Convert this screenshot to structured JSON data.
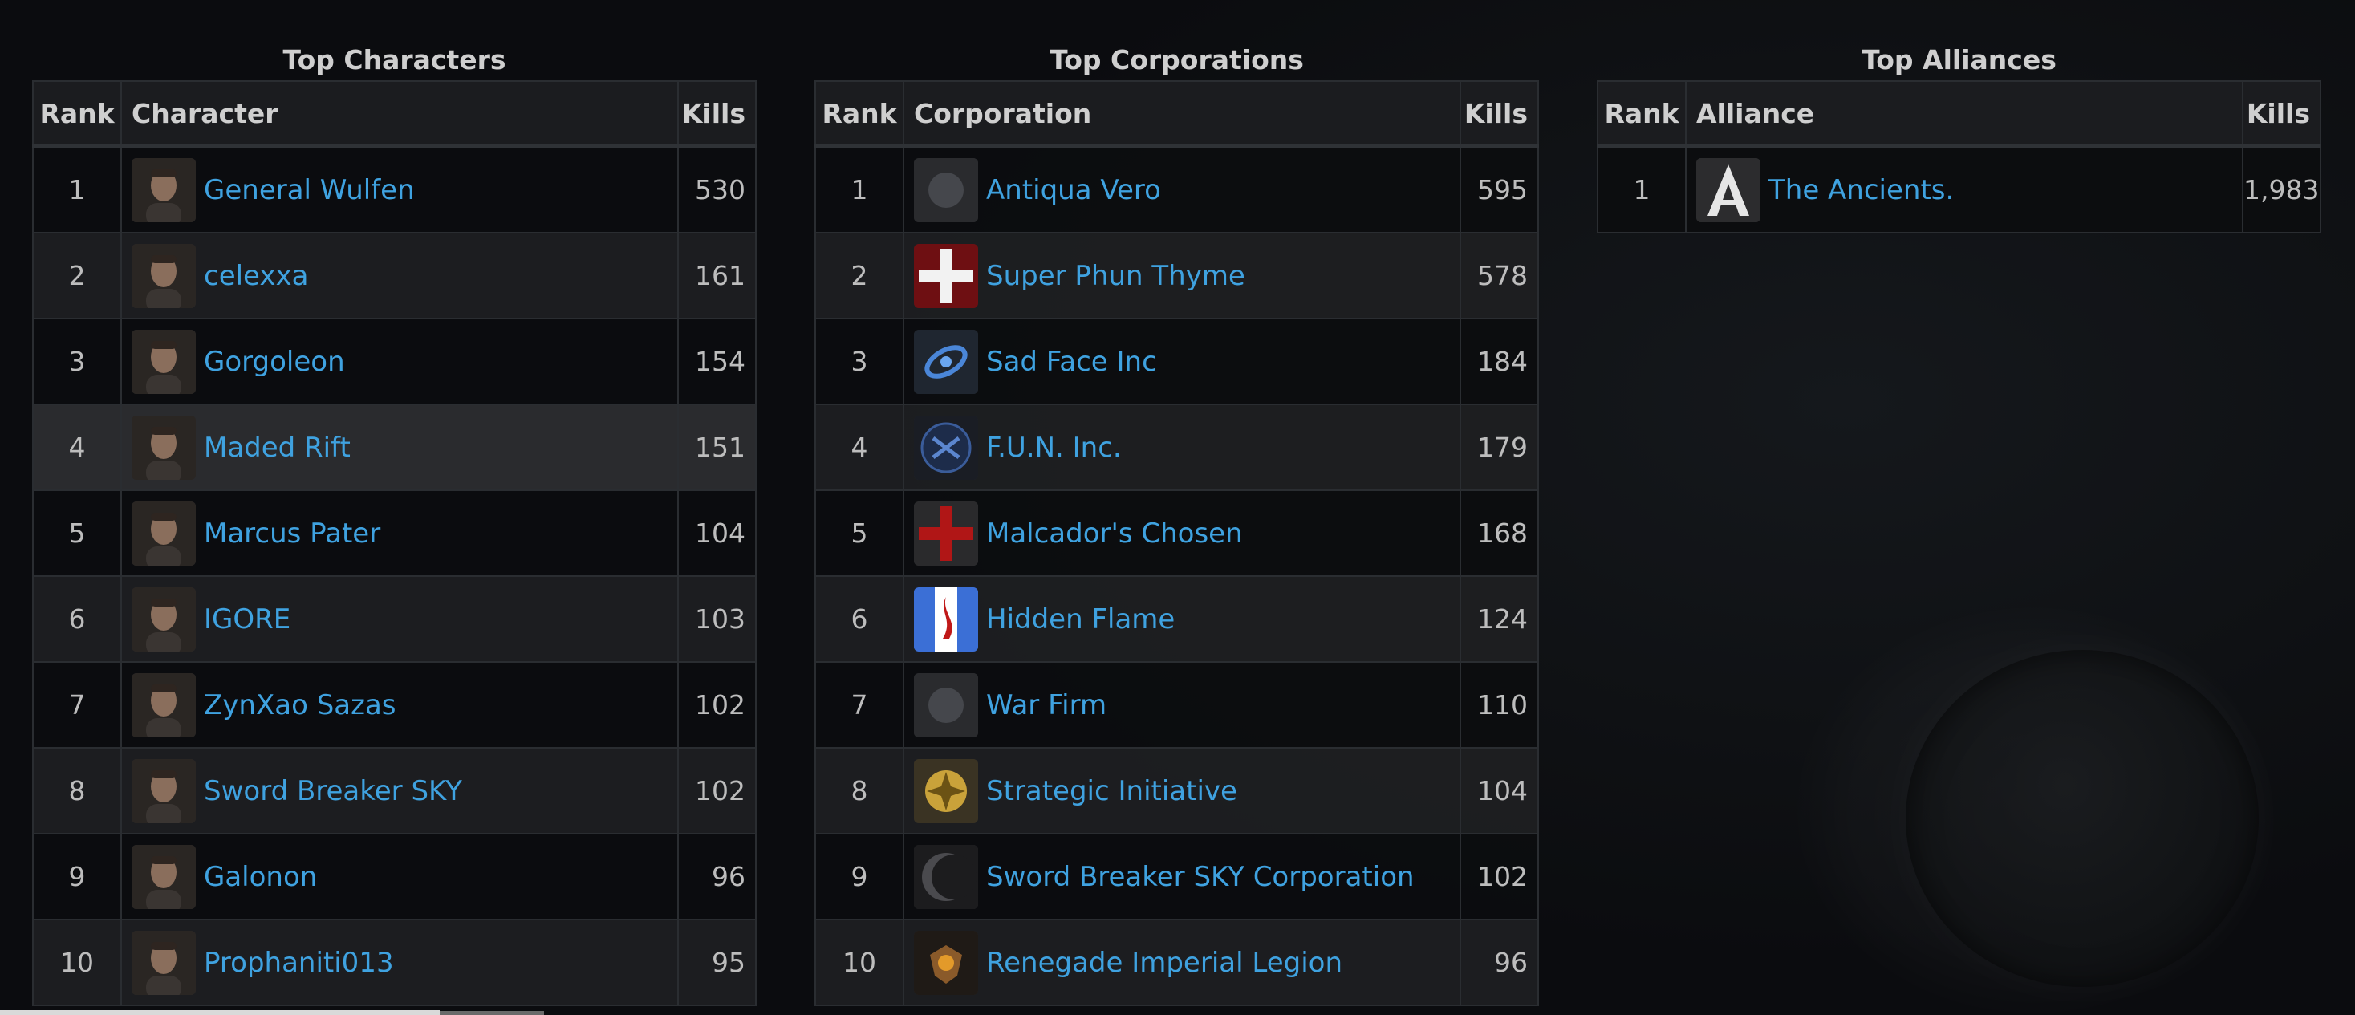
{
  "panels": [
    {
      "title": "Top Characters",
      "headers": {
        "rank": "Rank",
        "name": "Character",
        "kills": "Kills"
      },
      "rows": [
        {
          "rank": "1",
          "name": "General Wulfen",
          "kills": "530",
          "icon": "character-portrait-icon"
        },
        {
          "rank": "2",
          "name": "celexxa",
          "kills": "161",
          "icon": "character-portrait-icon"
        },
        {
          "rank": "3",
          "name": "Gorgoleon",
          "kills": "154",
          "icon": "character-portrait-icon"
        },
        {
          "rank": "4",
          "name": "Maded Rift",
          "kills": "151",
          "icon": "character-portrait-icon"
        },
        {
          "rank": "5",
          "name": "Marcus Pater",
          "kills": "104",
          "icon": "character-portrait-icon"
        },
        {
          "rank": "6",
          "name": "IGORE",
          "kills": "103",
          "icon": "character-portrait-icon"
        },
        {
          "rank": "7",
          "name": "ZynXao Sazas",
          "kills": "102",
          "icon": "character-portrait-icon"
        },
        {
          "rank": "8",
          "name": "Sword Breaker SKY",
          "kills": "102",
          "icon": "character-portrait-icon"
        },
        {
          "rank": "9",
          "name": "Galonon",
          "kills": "96",
          "icon": "character-portrait-icon"
        },
        {
          "rank": "10",
          "name": "Prophaniti013",
          "kills": "95",
          "icon": "character-portrait-icon"
        }
      ]
    },
    {
      "title": "Top Corporations",
      "headers": {
        "rank": "Rank",
        "name": "Corporation",
        "kills": "Kills"
      },
      "rows": [
        {
          "rank": "1",
          "name": "Antiqua Vero",
          "kills": "595",
          "icon": "corporation-logo-icon"
        },
        {
          "rank": "2",
          "name": "Super Phun Thyme",
          "kills": "578",
          "icon": "white-cross-logo-icon"
        },
        {
          "rank": "3",
          "name": "Sad Face Inc",
          "kills": "184",
          "icon": "blue-swirl-logo-icon"
        },
        {
          "rank": "4",
          "name": "F.U.N. Inc.",
          "kills": "179",
          "icon": "blue-emblem-logo-icon"
        },
        {
          "rank": "5",
          "name": "Malcador's Chosen",
          "kills": "168",
          "icon": "red-cross-logo-icon"
        },
        {
          "rank": "6",
          "name": "Hidden Flame",
          "kills": "124",
          "icon": "flame-logo-icon"
        },
        {
          "rank": "7",
          "name": "War Firm",
          "kills": "110",
          "icon": "corporation-logo-icon"
        },
        {
          "rank": "8",
          "name": "Strategic Initiative",
          "kills": "104",
          "icon": "gold-emblem-logo-icon"
        },
        {
          "rank": "9",
          "name": "Sword Breaker SKY Corporation",
          "kills": "102",
          "icon": "crescent-logo-icon"
        },
        {
          "rank": "10",
          "name": "Renegade Imperial Legion",
          "kills": "96",
          "icon": "winged-emblem-logo-icon"
        }
      ]
    },
    {
      "title": "Top Alliances",
      "headers": {
        "rank": "Rank",
        "name": "Alliance",
        "kills": "Kills"
      },
      "rows": [
        {
          "rank": "1",
          "name": "The Ancients.",
          "kills": "1,983",
          "icon": "alliance-logo-icon"
        }
      ]
    }
  ],
  "colors": {
    "link": "#3fa2e0",
    "background": "#0d0f12"
  }
}
